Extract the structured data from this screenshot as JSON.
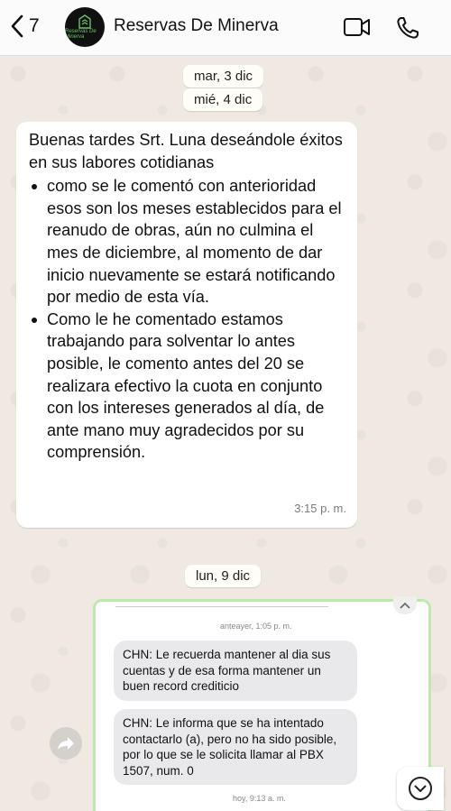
{
  "header": {
    "back_count": "7",
    "contact_name": "Reservas De Minerva",
    "avatar_logo_text": "Reservas De Minerva",
    "icons": [
      "back-chevron-icon",
      "video-call-icon",
      "phone-call-icon"
    ]
  },
  "dates": {
    "first": "mar, 3 dic",
    "second": "mié, 4 dic",
    "third": "lun, 9 dic"
  },
  "message": {
    "intro": "Buenas tardes Srt. Luna deseándole éxitos en sus labores cotidianas",
    "bullets": [
      "como se le comentó con anterioridad esos son los meses establecidos para el reanudo de obras, aún no culmina el mes de diciembre, al momento de dar inicio nuevamente se estará notificando por medio de esta vía.",
      "Como le he comentado estamos trabajando para solventar lo antes posible, le comento antes del 20 se realizara efectivo la cuota en conjunto con los intereses generados al día, de ante mano muy agradecidos por su comprensión."
    ],
    "time": "3:15 p. m."
  },
  "attachment": {
    "timestamp_top": "anteayer, 1:05 p. m.",
    "sms": [
      "CHN: Le recuerda mantener al dia sus cuentas y de esa forma mantener un buen record crediticio",
      "CHN: Le informa que se ha intentado contactarlo (a), pero no ha sido posible, por lo que se le solicita llamar al PBX 1507, num. 0"
    ],
    "timestamp_bottom": "hoy, 9:13 a. m."
  },
  "colors": {
    "chat_background": "#efe9e2",
    "bubble": "#ffffff",
    "sms_bubble": "#e9e9eb",
    "attachment_border": "#bfe8b0",
    "logo_green": "#6ac26a"
  }
}
